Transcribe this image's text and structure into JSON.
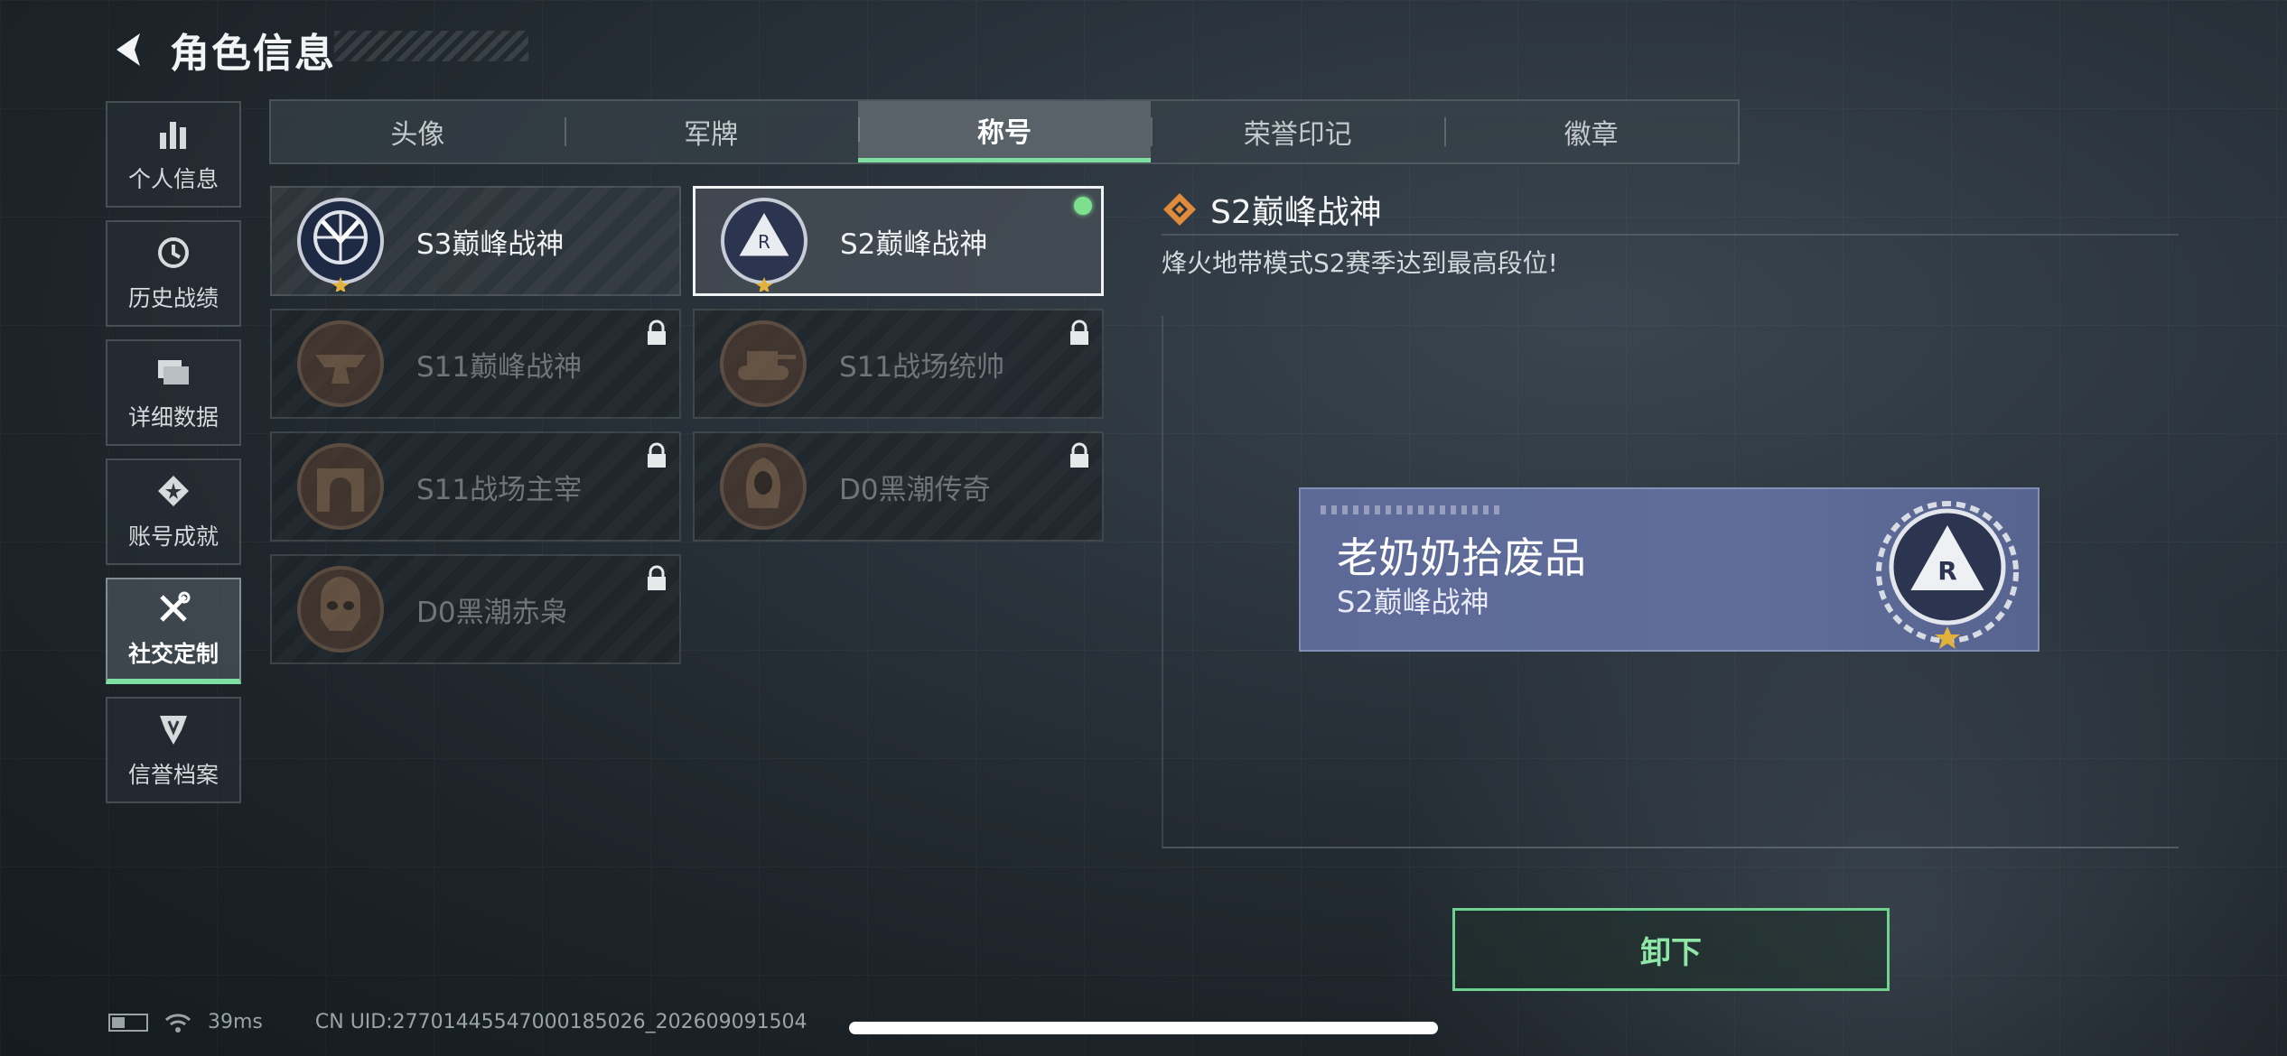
{
  "header": {
    "title": "角色信息",
    "back_icon": "back-chevron-icon"
  },
  "side_nav": [
    {
      "label": "个人信息",
      "icon": "bar-chart-icon",
      "active": false
    },
    {
      "label": "历史战绩",
      "icon": "history-clock-icon",
      "active": false
    },
    {
      "label": "详细数据",
      "icon": "folder-stack-icon",
      "active": false
    },
    {
      "label": "账号成就",
      "icon": "achievement-badge-icon",
      "active": false
    },
    {
      "label": "社交定制",
      "icon": "tools-wrench-icon",
      "active": true
    },
    {
      "label": "信誉档案",
      "icon": "credit-shield-icon",
      "active": false
    }
  ],
  "tabs": [
    {
      "label": "头像",
      "active": false
    },
    {
      "label": "军牌",
      "active": false
    },
    {
      "label": "称号",
      "active": true
    },
    {
      "label": "荣誉印记",
      "active": false
    },
    {
      "label": "徽章",
      "active": false
    }
  ],
  "titles": [
    {
      "name": "S3巅峰战神",
      "locked": false,
      "selected": false,
      "equipped": false,
      "emblem": "globe-eagle-emblem-icon"
    },
    {
      "name": "S2巅峰战神",
      "locked": false,
      "selected": true,
      "equipped": true,
      "emblem": "triangle-r-emblem-icon"
    },
    {
      "name": "S11巅峰战神",
      "locked": true,
      "selected": false,
      "equipped": false,
      "emblem": "anvil-emblem-icon"
    },
    {
      "name": "S11战场统帅",
      "locked": true,
      "selected": false,
      "equipped": false,
      "emblem": "tank-emblem-icon"
    },
    {
      "name": "S11战场主宰",
      "locked": true,
      "selected": false,
      "equipped": false,
      "emblem": "arch-emblem-icon"
    },
    {
      "name": "D0黑潮传奇",
      "locked": true,
      "selected": false,
      "equipped": false,
      "emblem": "hooded-figure-emblem-icon"
    },
    {
      "name": "D0黑潮赤枭",
      "locked": true,
      "selected": false,
      "equipped": false,
      "emblem": "skull-mask-emblem-icon"
    }
  ],
  "detail": {
    "title": "S2巅峰战神",
    "description": "烽火地带模式S2赛季达到最高段位!",
    "nameplate": {
      "player_name": "老奶奶拾废品",
      "title": "S2巅峰战神"
    },
    "unequip_label": "卸下"
  },
  "status_bar": {
    "ping": "39ms",
    "uid": "CN UID:27701445547000185026_202609091504"
  },
  "colors": {
    "accent_green": "#7ee0a0",
    "nameplate_blue": "#5d6a98",
    "diamond_orange": "#e08a3c"
  }
}
